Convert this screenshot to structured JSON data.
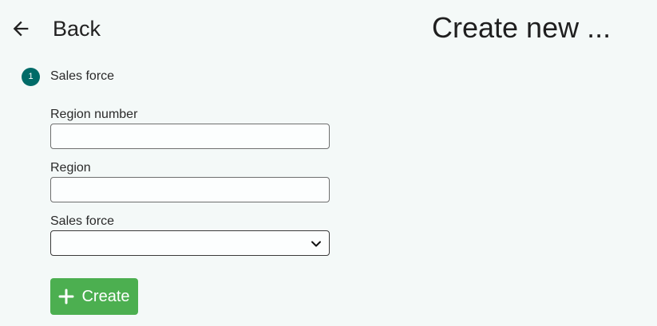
{
  "header": {
    "back_label": "Back",
    "title": "Create new ..."
  },
  "stepper": {
    "number": "1",
    "label": "Sales force"
  },
  "form": {
    "region_number": {
      "label": "Region number",
      "value": ""
    },
    "region": {
      "label": "Region",
      "value": ""
    },
    "sales_force": {
      "label": "Sales force",
      "selected": ""
    }
  },
  "actions": {
    "create_label": "Create"
  },
  "colors": {
    "background": "#f4f9f8",
    "step_badge": "#006b68",
    "create_button": "#4caf50"
  }
}
